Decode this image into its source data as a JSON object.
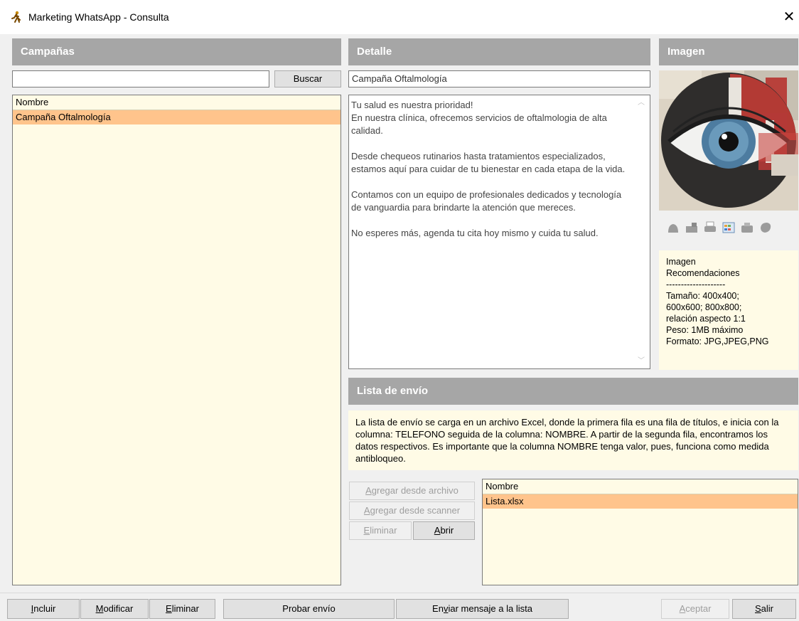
{
  "window": {
    "title": "Marketing WhatsApp - Consulta"
  },
  "campaigns": {
    "header": "Campañas",
    "search_value": "",
    "search_button": "Buscar",
    "column": "Nombre",
    "rows": [
      "Campaña Oftalmología"
    ]
  },
  "detail": {
    "header": "Detalle",
    "name_value": "Campaña Oftalmología",
    "message_lines": [
      "Tu salud es nuestra prioridad!",
      "En nuestra clínica, ofrecemos servicios de oftalmologia de alta calidad.",
      "Desde chequeos rutinarios hasta tratamientos especializados, estamos aquí para cuidar de tu bienestar en cada etapa de la vida.",
      "Contamos con un equipo de profesionales dedicados y tecnología de vanguardia para brindarte la atención que mereces.",
      "No esperes más, agenda tu cita hoy mismo y cuida tu salud."
    ]
  },
  "image": {
    "header": "Imagen",
    "info_lines": [
      "Imagen",
      "Recomendaciones",
      "--------------------",
      "Tamaño: 400x400;",
      "600x600; 800x800;",
      "relación aspecto 1:1",
      "Peso: 1MB máximo",
      "Formato: JPG,JPEG,PNG"
    ]
  },
  "send_list": {
    "header": "Lista de envío",
    "info": "La lista de envío se carga en un archivo Excel, donde la primera fila es una fila de títulos, e inicia con la columna: TELEFONO seguida de la columna: NOMBRE. A partir de la segunda fila, encontramos los datos respectivos. Es importante que la columna NOMBRE tenga valor, pues, funciona como medida antibloqueo.",
    "btn_add_file": {
      "first": "A",
      "rest": "gregar desde archivo"
    },
    "btn_add_scanner": {
      "first": "A",
      "rest": "gregar desde scanner"
    },
    "btn_delete": {
      "first": "E",
      "rest": "liminar"
    },
    "btn_open": {
      "first": "A",
      "rest": "brir"
    },
    "column": "Nombre",
    "rows": [
      "Lista.xlsx"
    ]
  },
  "footer": {
    "include": {
      "first": "I",
      "rest": "ncluir"
    },
    "modify": {
      "first": "M",
      "rest": "odificar"
    },
    "delete": {
      "first": "E",
      "rest": "liminar"
    },
    "test_send": "Probar envío",
    "send_to_list": {
      "pre": "En",
      "u": "v",
      "post": "iar mensaje a la lista"
    },
    "accept": {
      "first": "A",
      "rest": "ceptar"
    },
    "exit": {
      "first": "S",
      "rest": "alir"
    }
  },
  "colors": {
    "header_gray": "#a6a6a6",
    "list_bg": "#fffbe6",
    "selection": "#ffc48c"
  }
}
